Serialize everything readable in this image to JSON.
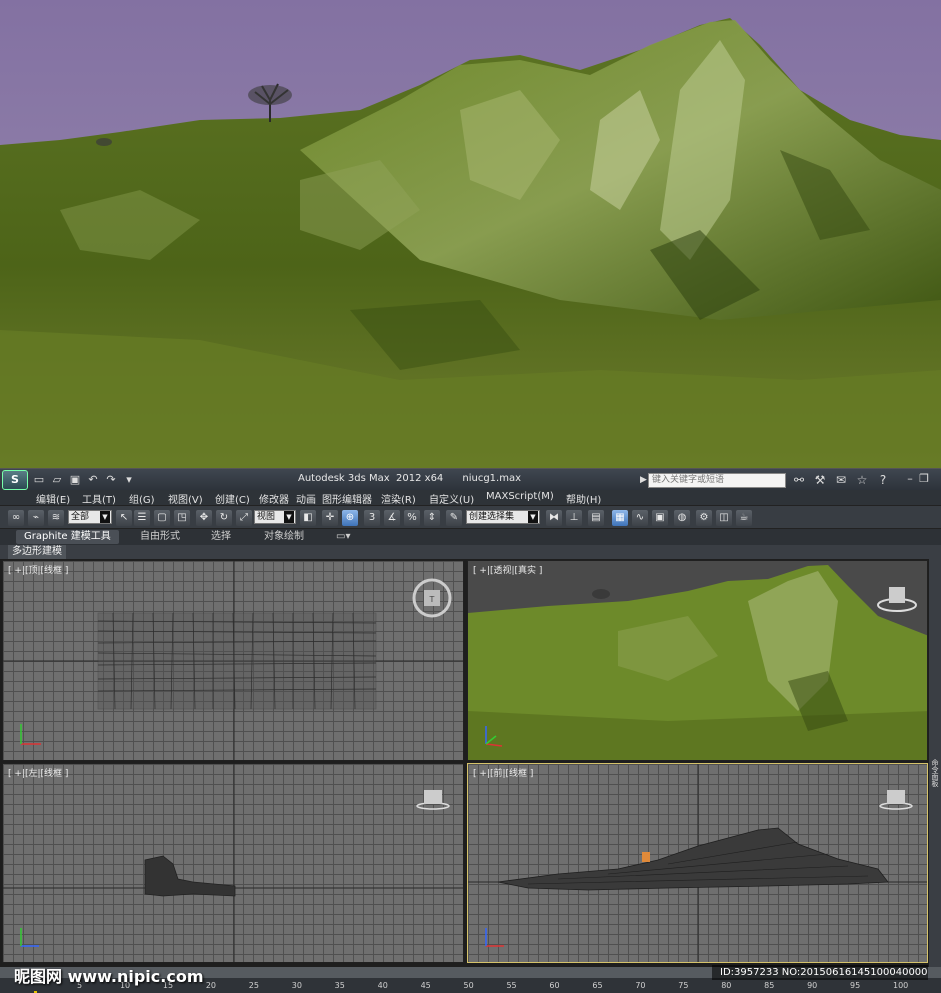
{
  "hero": {
    "sky_color": "#8a7aa0",
    "terrain_color": "#4f6a1e",
    "highlight_color": "#b7c48a"
  },
  "titlebar": {
    "app_icon": "3ds-max-logo",
    "title": "Autodesk 3ds Max  2012 x64      niucg1.max",
    "search_placeholder": "键入关键字或短语"
  },
  "menu": [
    {
      "label": "编辑(E)"
    },
    {
      "label": "工具(T)"
    },
    {
      "label": "组(G)"
    },
    {
      "label": "视图(V)"
    },
    {
      "label": "创建(C)"
    },
    {
      "label": "修改器"
    },
    {
      "label": "动画"
    },
    {
      "label": "图形编辑器"
    },
    {
      "label": "渲染(R)"
    },
    {
      "label": "自定义(U)"
    },
    {
      "label": "MAXScript(M)"
    },
    {
      "label": "帮助(H)"
    }
  ],
  "toolbar": {
    "selection_filter": "全部",
    "reference_coord": "视图",
    "named_selection": "创建选择集",
    "snap_3": "3",
    "percent_snap": "%"
  },
  "ribbon": {
    "tabs": [
      {
        "label": "Graphite 建模工具"
      },
      {
        "label": "自由形式"
      },
      {
        "label": "选择"
      },
      {
        "label": "对象绘制"
      }
    ],
    "panel": "多边形建模"
  },
  "viewports": {
    "top": {
      "label": "[ +|[顶|[线框 ]"
    },
    "persp": {
      "label": "[ +|[透视|[真实 ]"
    },
    "left": {
      "label": "[ +|[左|[线框 ]"
    },
    "front": {
      "label": "[ +|[前|[线框 ]"
    }
  },
  "side_panel": {
    "label": "命令面板"
  },
  "timeline": {
    "ticks": [
      "5",
      "10",
      "15",
      "20",
      "25",
      "30",
      "35",
      "40",
      "45",
      "50",
      "55",
      "60",
      "65",
      "70",
      "75",
      "80",
      "85",
      "90",
      "95",
      "100"
    ]
  },
  "watermark": {
    "left": "昵图网 www.nipic.com",
    "right": "ID:3957233 NO:20150616145100040000"
  }
}
